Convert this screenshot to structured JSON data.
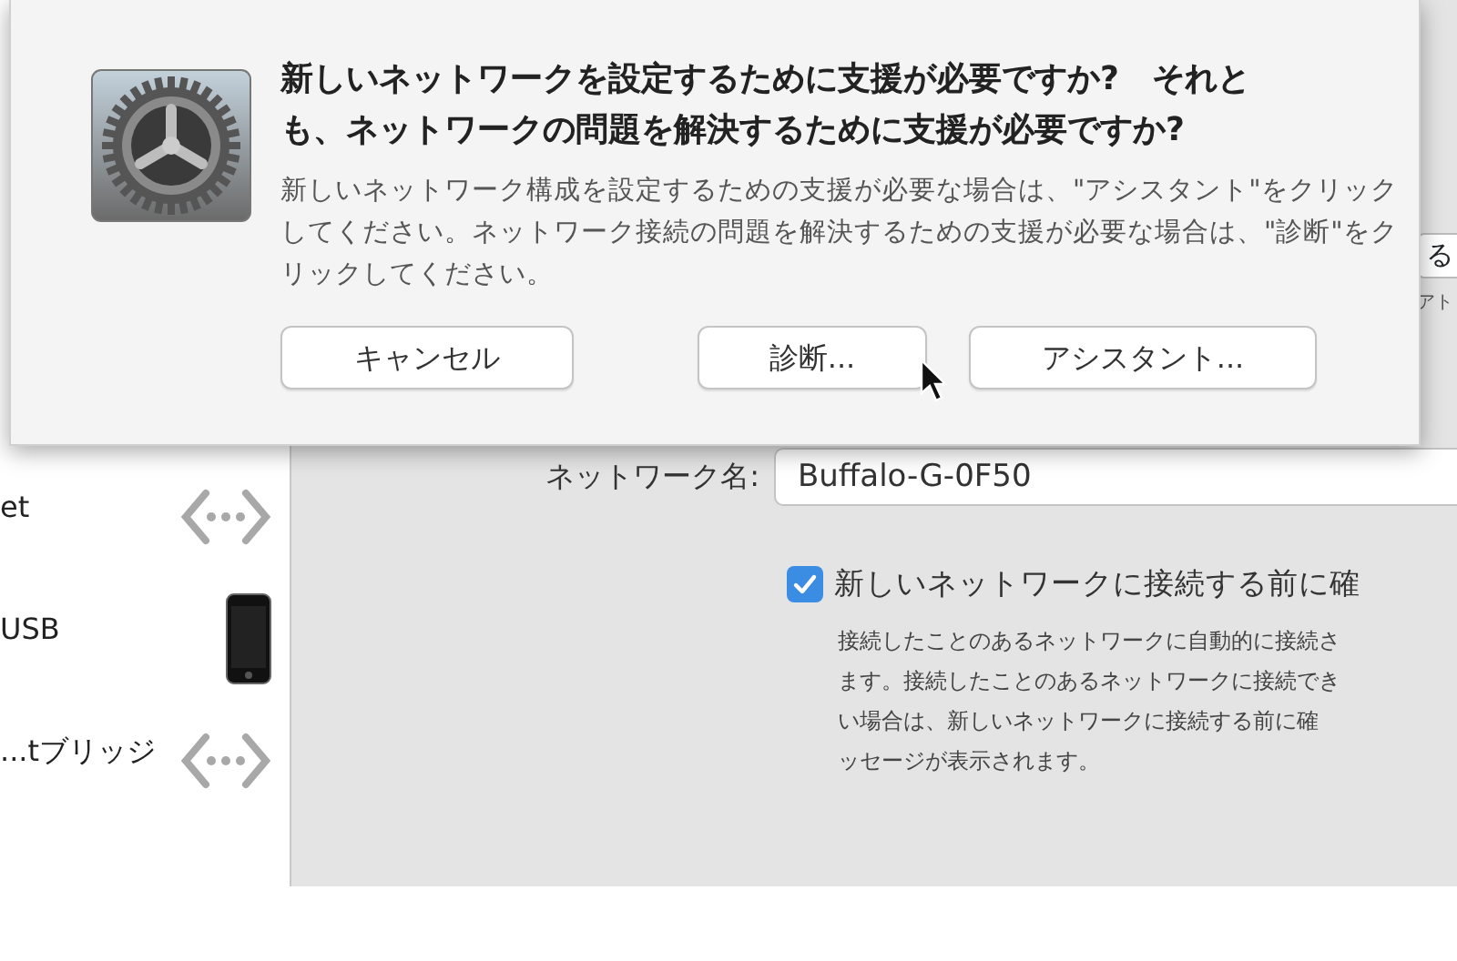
{
  "dialog": {
    "title": "新しいネットワークを設定するために支援が必要ですか?　それとも、ネットワークの問題を解決するために支援が必要ですか?",
    "message": "新しいネットワーク構成を設定するための支援が必要な場合は、\"アシスタント\"をクリックしてください。ネットワーク接続の問題を解決するための支援が必要な場合は、\"診断\"をクリックしてください。",
    "buttons": [
      {
        "label": "キャンセル"
      },
      {
        "label": "診断..."
      },
      {
        "label": "アシスタント..."
      }
    ]
  },
  "sidebar": {
    "items": [
      {
        "label": "et",
        "kind": "network"
      },
      {
        "label": "USB",
        "kind": "phone"
      },
      {
        "label": "...tブリッジ",
        "kind": "network"
      }
    ]
  },
  "panel": {
    "field_fragment": "る",
    "text_fragment": "アト",
    "network_name_label": "ネットワーク名:",
    "network_name_value": "Buffalo-G-0F50",
    "ask_checkbox": {
      "label": "新しいネットワークに接続する前に確",
      "checked": true
    },
    "description_lines": [
      "接続したことのあるネットワークに自動的に接続さ",
      "ます。接続したことのあるネットワークに接続でき",
      "い場合は、新しいネットワークに接続する前に確",
      "ッセージが表示されます。"
    ]
  }
}
